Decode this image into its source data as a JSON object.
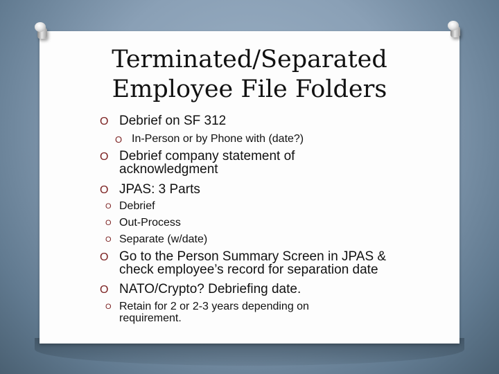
{
  "slide": {
    "title_line1": "Terminated/Separated",
    "title_line2": "Employee File Folders",
    "accent_color": "#7a1f1f",
    "bullet_glyph": "O",
    "items": [
      {
        "level": 1,
        "text": "Debrief on SF 312"
      },
      {
        "level": 2,
        "text": "In-Person or by Phone with (date?)"
      },
      {
        "level": 1,
        "text": "Debrief company statement of",
        "text2": "acknowledgment"
      },
      {
        "level": 1,
        "text": "JPAS: 3 Parts"
      },
      {
        "level": 2,
        "text": "Debrief"
      },
      {
        "level": 2,
        "text": "Out-Process"
      },
      {
        "level": 2,
        "text": "Separate (w/date)"
      },
      {
        "level": 1,
        "text": "Go to the Person Summary Screen in JPAS &",
        "text2": "check employee’s record for separation date"
      },
      {
        "level": 1,
        "text": "NATO/Crypto? Debriefing date."
      },
      {
        "level": 2,
        "text": "Retain for 2 or 2-3 years depending on",
        "text2": "requirement."
      }
    ]
  }
}
